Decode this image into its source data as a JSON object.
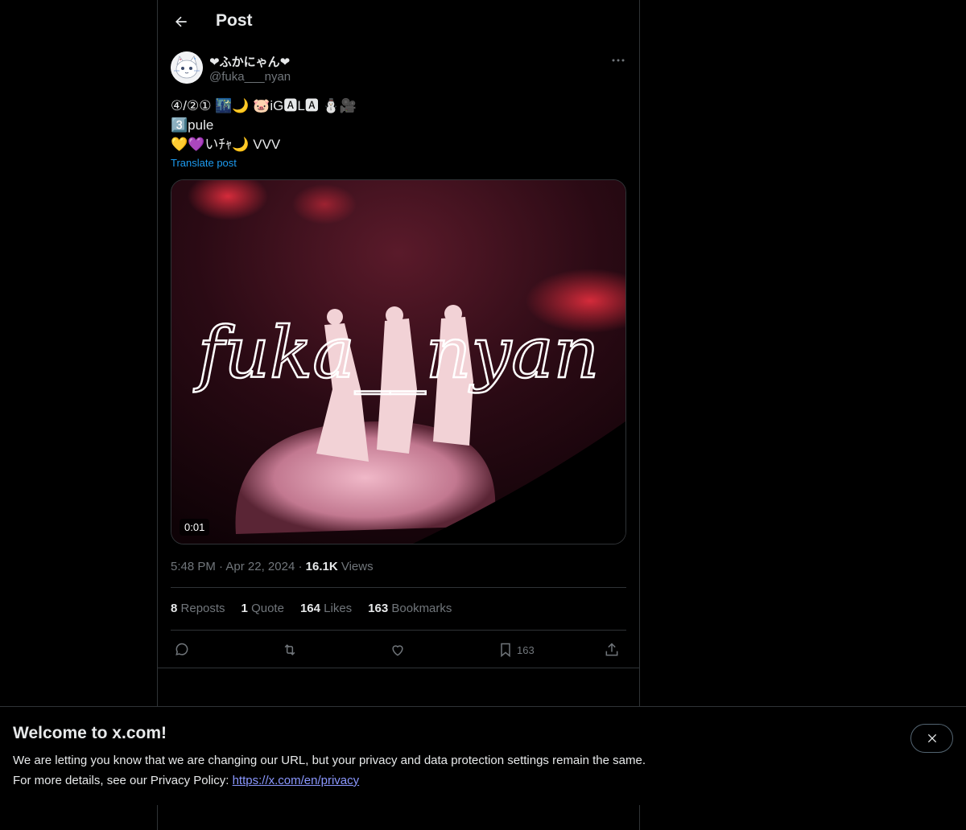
{
  "header": {
    "title": "Post",
    "back_icon": "arrow-left-icon"
  },
  "post": {
    "display_name": "❤ふかにゃん❤",
    "handle": "@fuka___nyan",
    "text_lines": [
      "④/②① 🌃🌙 🐷iG🅰L🅰 ⛄🎥",
      "3️⃣pule",
      "💛💜いﾁｬ🌙 VVV"
    ],
    "translate_label": "Translate post",
    "media": {
      "overlay_text": "fuka__nyan",
      "duration": "0:01"
    },
    "time": "5:48 PM",
    "date": "Apr 22, 2024",
    "views_count": "16.1K",
    "views_label": "Views",
    "stats": {
      "reposts_count": "8",
      "reposts_label": "Reposts",
      "quotes_count": "1",
      "quotes_label": "Quote",
      "likes_count": "164",
      "likes_label": "Likes",
      "bookmarks_count": "163",
      "bookmarks_label": "Bookmarks"
    },
    "action_bookmark_count": "163"
  },
  "banner": {
    "title": "Welcome to x.com!",
    "line1": "We are letting you know that we are changing our URL, but your privacy and data protection settings remain the same.",
    "line2_prefix": "For more details, see our Privacy Policy: ",
    "link_text": "https://x.com/en/privacy"
  }
}
